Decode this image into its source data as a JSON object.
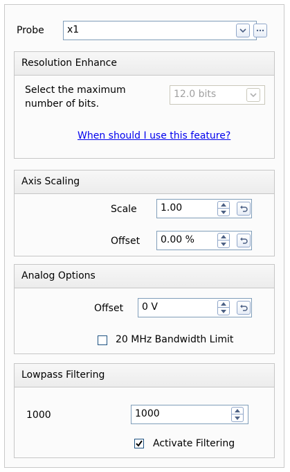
{
  "probe": {
    "label": "Probe",
    "value": "x1"
  },
  "resolution": {
    "title": "Resolution Enhance",
    "description_line1": "Select the maximum",
    "description_line2": "number of bits.",
    "bits_value": "12.0 bits",
    "help_link": "When should I use this feature?"
  },
  "axis_scaling": {
    "title": "Axis Scaling",
    "scale_label": "Scale",
    "scale_value": "1.00",
    "offset_label": "Offset",
    "offset_value": "0.00 %"
  },
  "analog": {
    "title": "Analog Options",
    "offset_label": "Offset",
    "offset_value": "0 V",
    "bw_limit_label": "20 MHz Bandwidth Limit",
    "bw_limit_checked": false
  },
  "lowpass": {
    "title": "Lowpass Filtering",
    "left_value": "1000",
    "field_value": "1000",
    "activate_label": "Activate Filtering",
    "activate_checked": true
  },
  "icons": {
    "dropdown": "chevron-down-icon",
    "more": "ellipsis-icon",
    "spin_up": "spin-up-icon",
    "spin_down": "spin-down-icon",
    "reset": "undo-icon"
  }
}
